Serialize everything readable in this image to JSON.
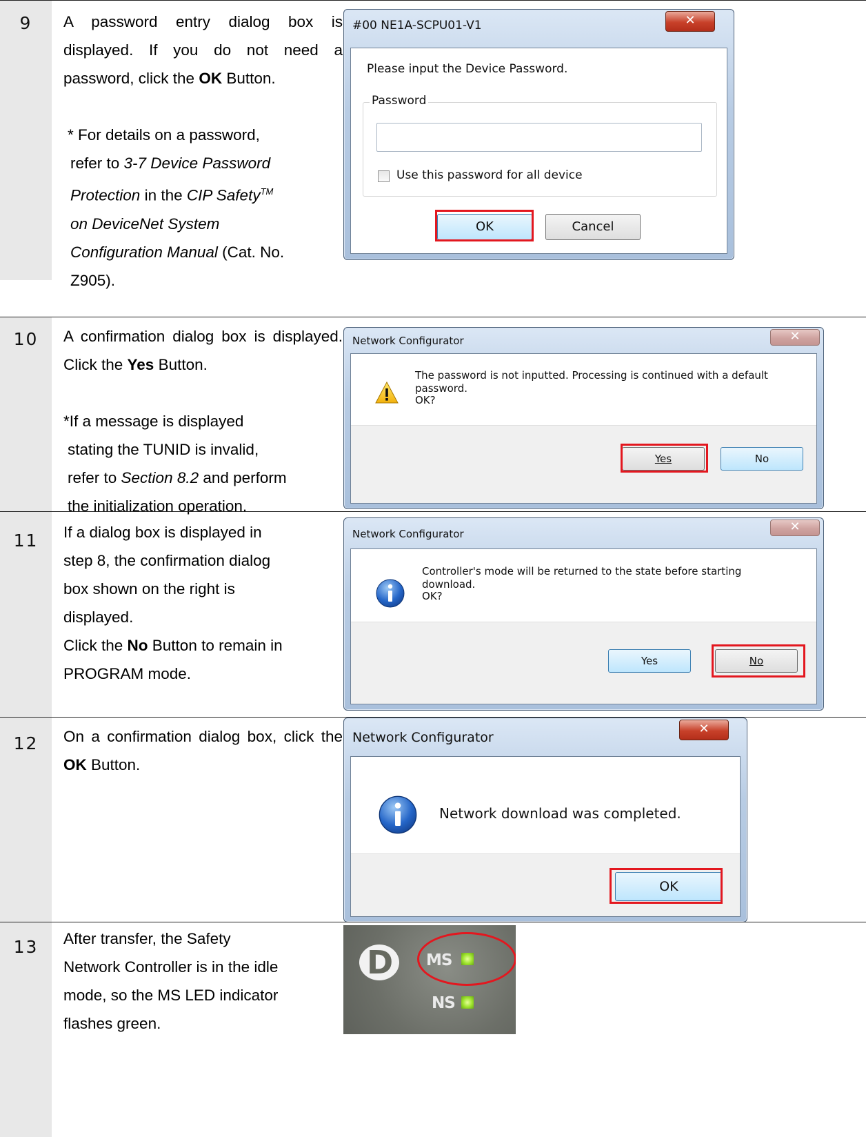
{
  "steps": [
    {
      "num": "9",
      "p1": "A password entry dialog box is displayed. If you do not need a password, click the ",
      "p1_bold": "OK",
      "p1_end": " Button.",
      "note_a": "* For details on a password,",
      "note_b": "refer to ",
      "note_b_it": "3-7 Device Password",
      "note_c_it": "Protection",
      "note_c": " in the ",
      "note_c_it2": "CIP Safety",
      "note_c_sup": "TM",
      "note_d_it": "on DeviceNet System",
      "note_e_it": "Configuration Manual",
      "note_e": " (Cat. No.",
      "note_f": "Z905).",
      "dialog": {
        "title": "#00 NE1A-SCPU01-V1",
        "prompt": "Please input the Device Password.",
        "group_label": "Password",
        "password_value": "",
        "checkbox_label": "Use this password for all device",
        "ok_label": "OK",
        "cancel_label": "Cancel"
      }
    },
    {
      "num": "10",
      "p1": "A confirmation dialog box is displayed. Click the ",
      "p1_bold": "Yes",
      "p1_end": " Button.",
      "note_a": "*If a message is displayed",
      "note_b": "stating the TUNID is invalid,",
      "note_c": "refer to ",
      "note_c_it": "Section 8.2",
      "note_c_end": " and perform",
      "note_d": "the initialization operation.",
      "dialog": {
        "title": "Network Configurator",
        "message_1": "The password is not inputted. Processing is continued with a default",
        "message_2": "password.",
        "message_3": "OK?",
        "yes_label": "Yes",
        "no_label": "No"
      }
    },
    {
      "num": "11",
      "l1": "If a dialog box is displayed in",
      "l2": "step 8, the confirmation dialog",
      "l3": "box shown on the right is",
      "l4": "displayed.",
      "l5_a": "Click the ",
      "l5_bold": "No",
      "l5_b": " Button to remain in",
      "l6": "PROGRAM mode.",
      "dialog": {
        "title": "Network Configurator",
        "message_1": "Controller's mode will be returned to the state before starting",
        "message_2": "download.",
        "message_3": "OK?",
        "yes_label": "Yes",
        "no_label": "No"
      }
    },
    {
      "num": "12",
      "p1": "On a confirmation dialog box, click the ",
      "p1_bold": "OK",
      "p1_end": " Button.",
      "dialog": {
        "title": "Network Configurator",
        "message": "Network download was completed.",
        "ok_label": "OK"
      }
    },
    {
      "num": "13",
      "l1": "After transfer, the Safety",
      "l2": "Network Controller is in the idle",
      "l3": "mode, so the MS LED indicator",
      "l4": "flashes green.",
      "photo": {
        "ms_label": "MS",
        "ns_label": "NS",
        "logo_letter": "D",
        "led_color": "#9be22a"
      }
    }
  ]
}
